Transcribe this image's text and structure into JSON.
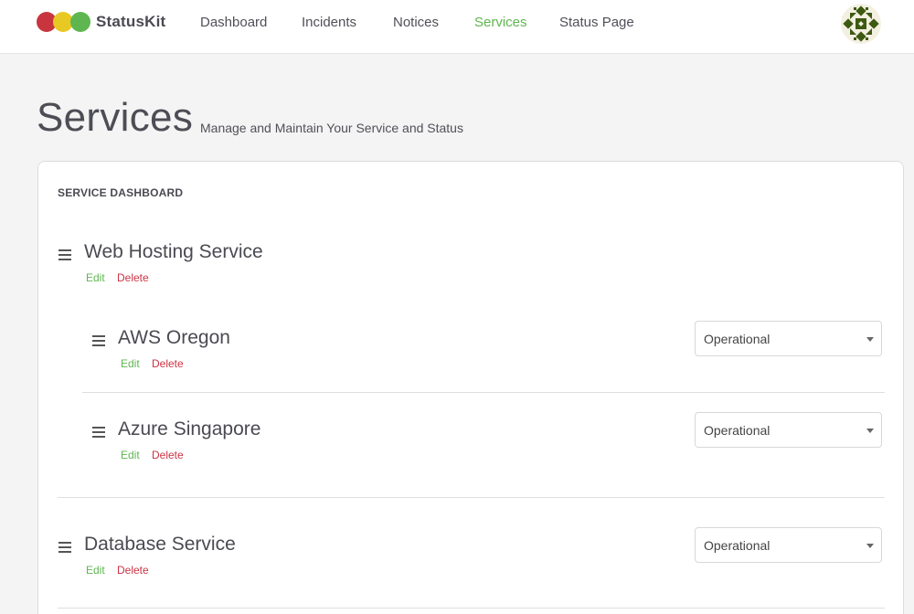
{
  "app": {
    "brand": "StatusKit",
    "logo_colors": [
      "#c9353f",
      "#e8c923",
      "#5fb650"
    ]
  },
  "nav": {
    "items": [
      {
        "label": "Dashboard"
      },
      {
        "label": "Incidents"
      },
      {
        "label": "Notices"
      },
      {
        "label": "Services",
        "active": true
      },
      {
        "label": "Status Page"
      }
    ],
    "active_color": "#5fb650"
  },
  "header": {
    "title": "Services",
    "subtitle": "Manage and Maintain Your Service and Status"
  },
  "dashboard": {
    "heading": "SERVICE DASHBOARD",
    "edit_label": "Edit",
    "delete_label": "Delete",
    "groups": [
      {
        "name": "Web Hosting Service",
        "children": [
          {
            "name": "AWS Oregon",
            "status": "Operational"
          },
          {
            "name": "Azure Singapore",
            "status": "Operational"
          }
        ]
      },
      {
        "name": "Database Service",
        "status": "Operational"
      }
    ]
  },
  "icons": {
    "drag": "drag-handle-icon",
    "dropdown": "chevron-down-icon",
    "avatar": "avatar-identicon"
  }
}
